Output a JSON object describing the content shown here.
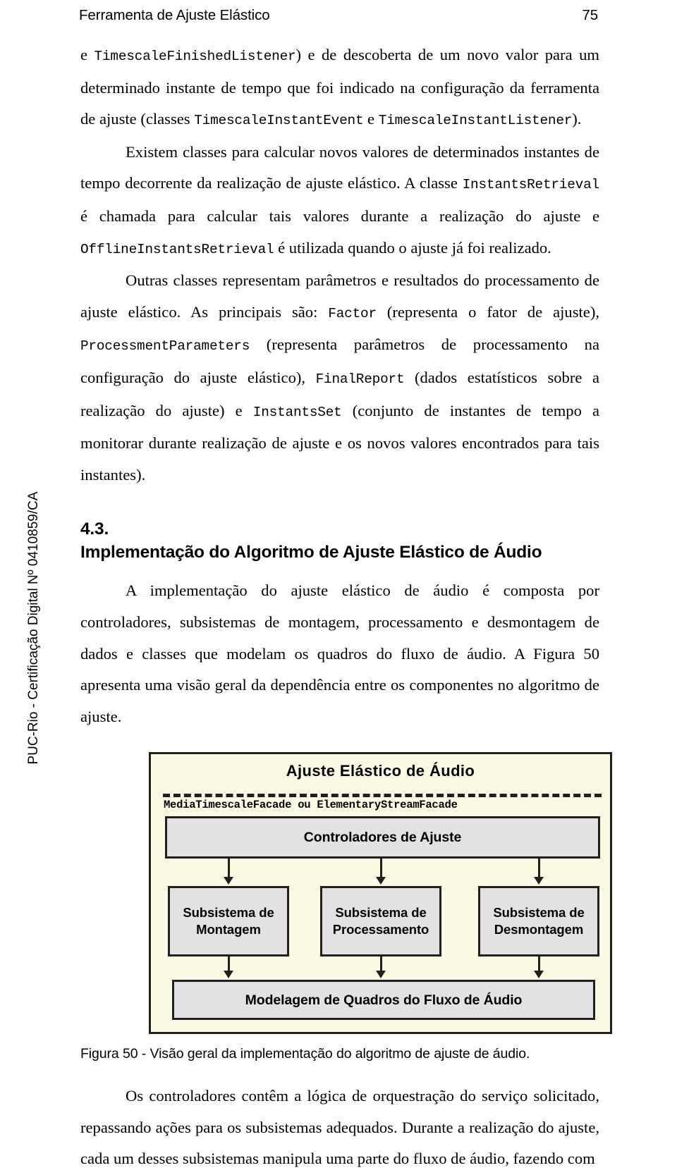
{
  "header": {
    "running_title": "Ferramenta de Ajuste Elástico",
    "page_number": "75"
  },
  "watermark": {
    "text": "PUC-Rio - Certificação Digital Nº 0410859/CA"
  },
  "body": {
    "para1": {
      "seg1": "e ",
      "code1": "TimescaleFinishedListener",
      "seg2": ") e de descoberta de um novo valor para um determinado instante de tempo que foi indicado na configuração da ferramenta de ajuste (classes ",
      "code2": "TimescaleInstantEvent",
      "seg3": " e ",
      "code3": "TimescaleInstantListener",
      "seg4": ")."
    },
    "para2": {
      "seg1": "Existem classes para calcular novos valores de determinados instantes de tempo decorrente da realização de ajuste elástico. A classe ",
      "code1": "InstantsRetrieval",
      "seg2": " é chamada para calcular tais valores durante a realização do ajuste e ",
      "code2": "OfflineInstantsRetrieval",
      "seg3": " é utilizada quando o ajuste já foi realizado."
    },
    "para3": {
      "seg1": "Outras classes representam parâmetros e resultados do processamento de ajuste elástico. As principais são: ",
      "code1": "Factor",
      "seg2": " (representa o fator de ajuste), ",
      "code2": "ProcessmentParameters",
      "seg3": " (representa parâmetros de processamento na configuração do ajuste elástico), ",
      "code3": "FinalReport",
      "seg4": " (dados estatísticos sobre a realização do ajuste) e ",
      "code4": "InstantsSet",
      "seg5": " (conjunto de instantes de tempo a monitorar durante realização de ajuste e os novos valores encontrados para tais instantes)."
    },
    "para4": "A implementação do ajuste elástico de áudio é composta por controladores, subsistemas de montagem, processamento e desmontagem de dados e classes que modelam os quadros do fluxo de áudio. A Figura 50 apresenta uma visão geral da dependência entre os componentes no algoritmo de ajuste.",
    "para5": "Os controladores contêm a lógica de orquestração do serviço solicitado, repassando ações para os subsistemas adequados. Durante a realização do ajuste, cada um desses subsistemas manipula uma parte do fluxo de áudio, fazendo com"
  },
  "section": {
    "number": "4.3.",
    "title": "Implementação do Algoritmo de Ajuste Elástico de Áudio"
  },
  "figure": {
    "caption": "Figura 50 - Visão geral da implementação do algoritmo de ajuste de áudio.",
    "diagram": {
      "title": "Ajuste Elástico de Áudio",
      "facade_label": "MediaTimescaleFacade ou ElementaryStreamFacade",
      "controllers_node": "Controladores de Ajuste",
      "subsystems": [
        "Subsistema de Montagem",
        "Subsistema de Processamento",
        "Subsistema de Desmontagem"
      ],
      "model_node": "Modelagem de Quadros do Fluxo de Áudio",
      "colors": {
        "panel_background": "#fbfae4",
        "node_fill": "#e2e2e2",
        "stroke": "#231f1c"
      }
    }
  }
}
